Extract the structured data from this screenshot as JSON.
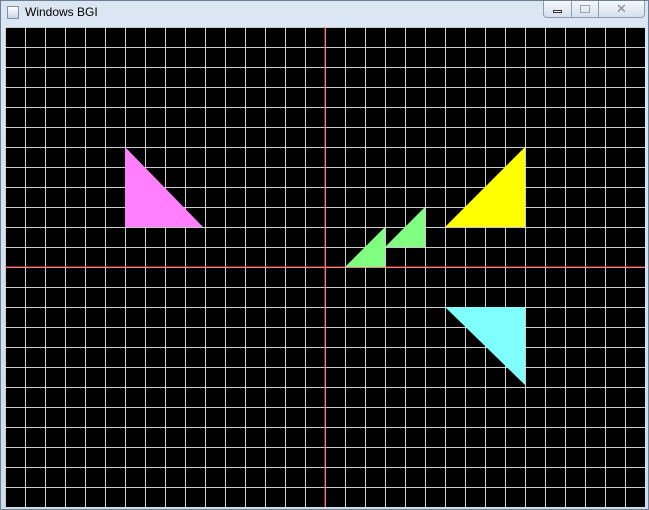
{
  "window": {
    "title": "Windows BGI",
    "icon": "app-icon",
    "controls": [
      {
        "name": "minimize-button",
        "icon": "minimize-icon"
      },
      {
        "name": "maximize-button",
        "icon": "maximize-icon",
        "enabled": false
      },
      {
        "name": "close-button",
        "icon": "close-icon"
      }
    ]
  },
  "canvas": {
    "background": "#000000",
    "grid_color": "#ffffff",
    "axis_color": "#ff4040",
    "shapes": [
      {
        "name": "magenta-triangle",
        "color": "#ff7fff"
      },
      {
        "name": "yellow-triangle",
        "color": "#ffff00"
      },
      {
        "name": "green-triangle-small-left",
        "color": "#80ff80"
      },
      {
        "name": "green-triangle-small-right",
        "color": "#80ff80"
      },
      {
        "name": "cyan-triangle",
        "color": "#80ffff"
      }
    ]
  }
}
